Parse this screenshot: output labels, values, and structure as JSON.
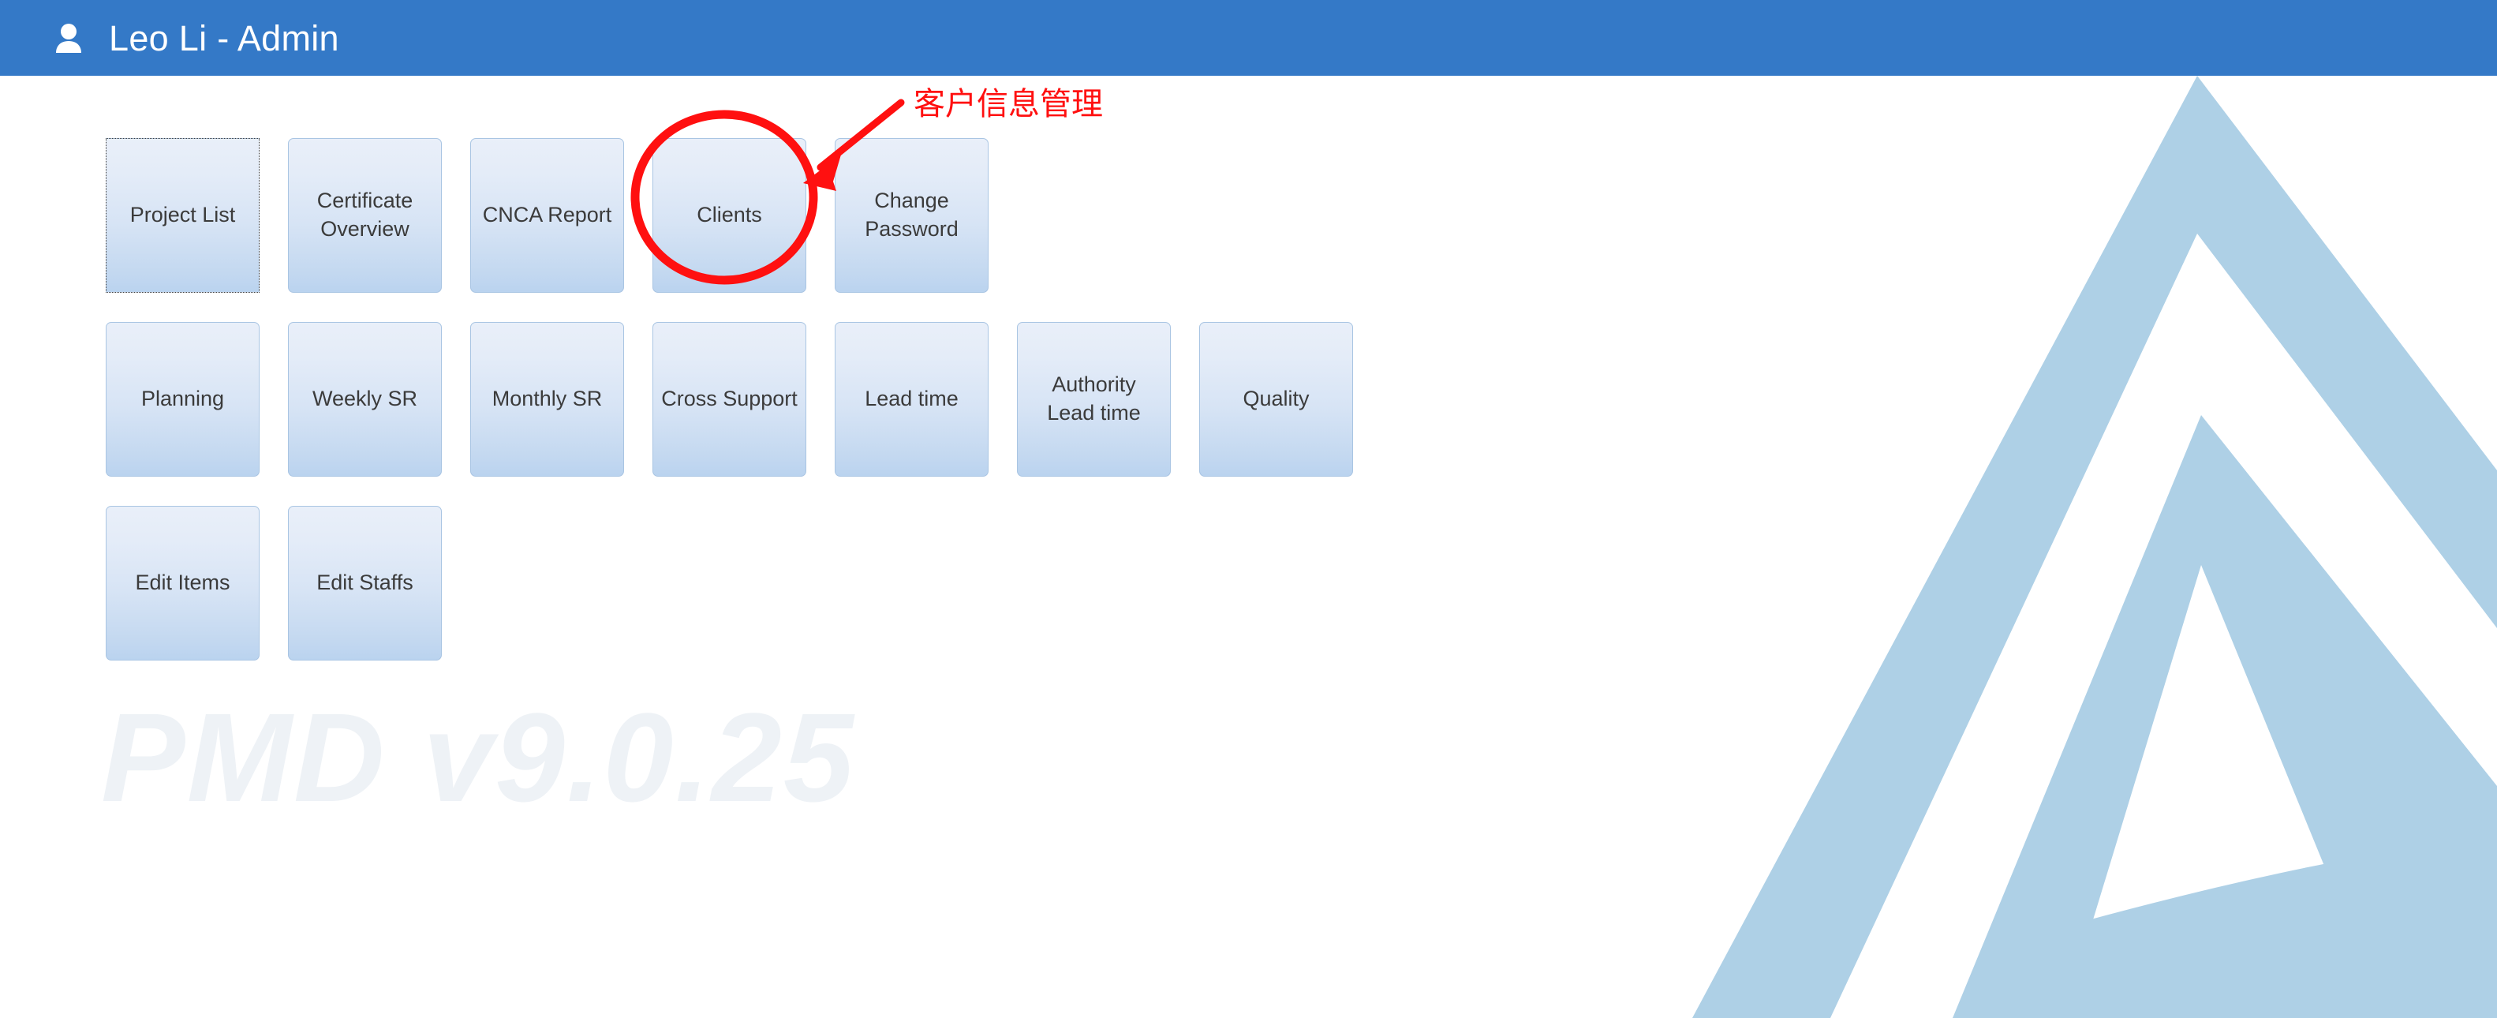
{
  "header": {
    "user_icon": "user-icon",
    "title": "Leo Li - Admin",
    "background_color": "#3479c7",
    "text_color": "#ffffff"
  },
  "tiles": {
    "rows": [
      [
        {
          "label": "Project List",
          "name": "tile-project-list",
          "focused": true
        },
        {
          "label": "Certificate Overview",
          "name": "tile-certificate-overview",
          "focused": false
        },
        {
          "label": "CNCA Report",
          "name": "tile-cnca-report",
          "focused": false
        },
        {
          "label": "Clients",
          "name": "tile-clients",
          "focused": false
        },
        {
          "label": "Change Password",
          "name": "tile-change-password",
          "focused": false
        }
      ],
      [
        {
          "label": "Planning",
          "name": "tile-planning",
          "focused": false
        },
        {
          "label": "Weekly SR",
          "name": "tile-weekly-sr",
          "focused": false
        },
        {
          "label": "Monthly SR",
          "name": "tile-monthly-sr",
          "focused": false
        },
        {
          "label": "Cross Support",
          "name": "tile-cross-support",
          "focused": false
        },
        {
          "label": "Lead time",
          "name": "tile-lead-time",
          "focused": false
        },
        {
          "label": "Authority Lead time",
          "name": "tile-authority-lead-time",
          "focused": false
        },
        {
          "label": "Quality",
          "name": "tile-quality",
          "focused": false
        }
      ],
      [
        {
          "label": "Edit Items",
          "name": "tile-edit-items",
          "focused": false
        },
        {
          "label": "Edit Staffs",
          "name": "tile-edit-staffs",
          "focused": false
        }
      ]
    ],
    "tile_border_color": "#a9c5e3",
    "tile_text_color": "#3b3b3b"
  },
  "watermark": {
    "version_text": "PMD v9.0.25",
    "color": "#eef2f6"
  },
  "logo": {
    "name": "triangle-chevron-logo",
    "color": "#aed0e6"
  },
  "annotation": {
    "note_text": "客户信息管理",
    "color": "#ff1010",
    "highlight_shape": "ellipse",
    "highlight_target": "Clients",
    "arrow": "arrow-pointing-to-clients-tile"
  }
}
